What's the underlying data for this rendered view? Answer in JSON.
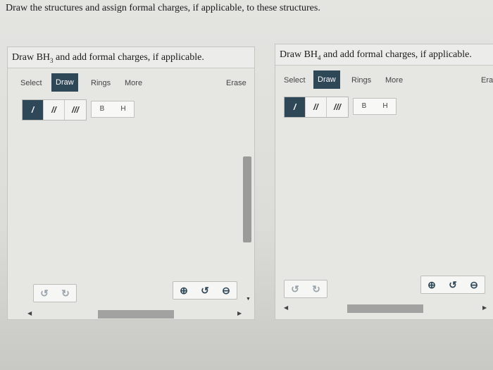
{
  "page": {
    "heading": "Draw the structures and assign formal charges, if applicable, to these structures."
  },
  "left_panel": {
    "prompt_prefix": "Draw BH",
    "prompt_sub": "3",
    "prompt_suffix": " and add formal charges, if applicable.",
    "tabs": [
      "Select",
      "Draw",
      "Rings",
      "More",
      "Erase"
    ],
    "active_tab": "Draw",
    "bonds": [
      "/",
      "//",
      "///"
    ],
    "atoms": [
      "B",
      "H"
    ],
    "undo_icon": "undo-icon",
    "redo_icon": "redo-icon",
    "zoom_in_icon": "zoom-in-icon",
    "reset_zoom_icon": "reset-zoom-icon",
    "zoom_out_icon": "zoom-out-icon"
  },
  "right_panel": {
    "prompt_prefix": "Draw BH",
    "prompt_sub": "4",
    "prompt_suffix": " and add formal charges, if applicable.",
    "tabs": [
      "Select",
      "Draw",
      "Rings",
      "More",
      "Era"
    ],
    "active_tab": "Draw",
    "bonds": [
      "/",
      "//",
      "///"
    ],
    "atoms": [
      "B",
      "H"
    ]
  },
  "colors": {
    "accent": "#2f4858",
    "panel_bg": "#e6e6e3"
  }
}
